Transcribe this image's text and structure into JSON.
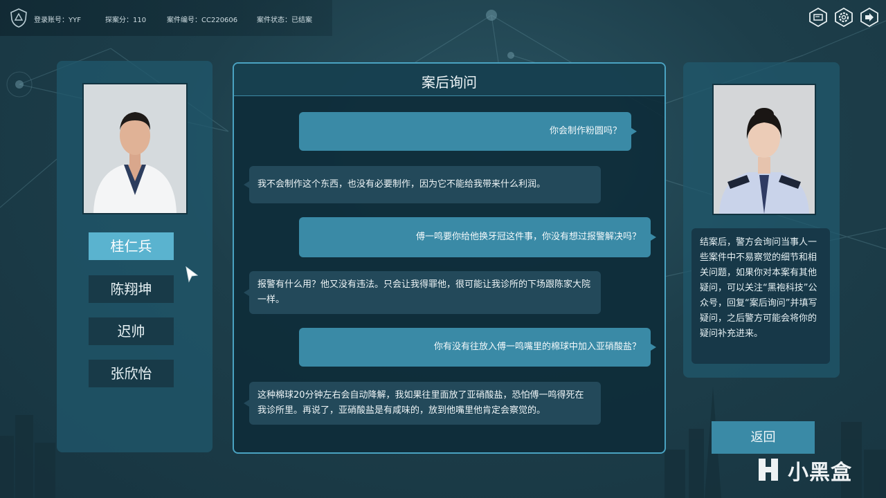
{
  "header": {
    "account": "登录账号：YYF",
    "score": "探案分：110",
    "case_no": "案件编号：CC220606",
    "case_status": "案件状态：已结案"
  },
  "top_buttons": [
    "editor-icon",
    "settings-gear-icon",
    "exit-icon"
  ],
  "characters": {
    "items": [
      {
        "label": "桂仁兵",
        "active": true
      },
      {
        "label": "陈翔坤",
        "active": false
      },
      {
        "label": "迟帅",
        "active": false
      },
      {
        "label": "张欣怡",
        "active": false
      }
    ]
  },
  "dialog": {
    "title": "案后询问",
    "messages": [
      {
        "role": "question",
        "text": "你会制作粉圆吗？"
      },
      {
        "role": "answer",
        "text": "我不会制作这个东西，也没有必要制作，因为它不能给我带来什么利润。"
      },
      {
        "role": "question",
        "text": "傅一鸣要你给他换牙冠这件事，你没有想过报警解决吗？"
      },
      {
        "role": "answer",
        "text": "报警有什么用？他又没有违法。只会让我得罪他，很可能让我诊所的下场跟陈家大院一样。"
      },
      {
        "role": "question",
        "text": "你有没有往放入傅一鸣嘴里的棉球中加入亚硝酸盐？"
      },
      {
        "role": "answer",
        "text": "这种棉球20分钟左右会自动降解，我如果往里面放了亚硝酸盐，恐怕傅一鸣得死在我诊所里。再说了，亚硝酸盐是有咸味的，放到他嘴里他肯定会察觉的。"
      }
    ]
  },
  "info": {
    "text": "结案后，警方会询问当事人一些案件中不易察觉的细节和相关问题，如果你对本案有其他疑问，可以关注“黑袍科技”公众号，回复“案后询问”并填写疑问，之后警方可能会将你的疑问补充进来。"
  },
  "back_label": "返回",
  "watermark": "小黑盒",
  "colors": {
    "accent": "#3a8aa6",
    "active_tab": "#5ab3cf",
    "panel": "#20586c",
    "dark": "#173848"
  }
}
